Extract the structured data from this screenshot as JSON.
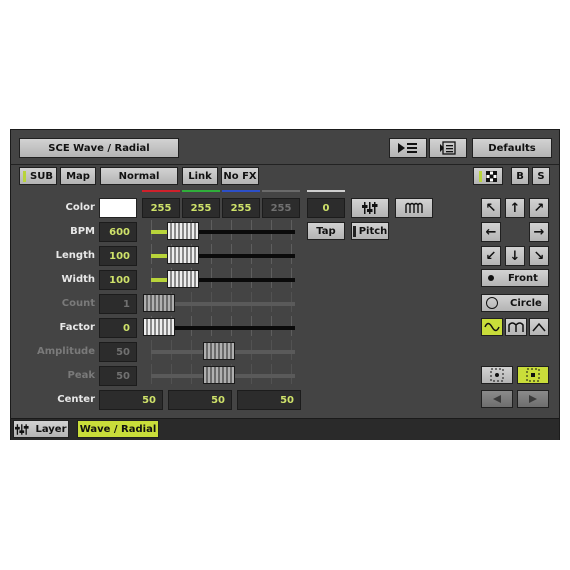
{
  "header": {
    "title": "SCE Wave / Radial",
    "defaults_label": "Defaults"
  },
  "tabs": {
    "sub": "SUB",
    "map": "Map",
    "mode": "Normal",
    "link": "Link",
    "nofx": "No FX",
    "b": "B",
    "s": "S"
  },
  "params": {
    "color": {
      "label": "Color",
      "r": "255",
      "g": "255",
      "b": "255",
      "w": "255",
      "alpha": "0"
    },
    "bpm": {
      "label": "BPM",
      "value": "600",
      "slider": 0.2
    },
    "length": {
      "label": "Length",
      "value": "100",
      "slider": 0.2
    },
    "width": {
      "label": "Width",
      "value": "100",
      "slider": 0.2
    },
    "count": {
      "label": "Count",
      "value": "1",
      "slider": 0.0
    },
    "factor": {
      "label": "Factor",
      "value": "0",
      "slider": 0.0
    },
    "amplitude": {
      "label": "Amplitude",
      "value": "50",
      "slider": 0.5
    },
    "peak": {
      "label": "Peak",
      "value": "50",
      "slider": 0.5
    },
    "center": {
      "label": "Center",
      "x": "50",
      "y": "50",
      "z": "50"
    }
  },
  "buttons": {
    "tap": "Tap",
    "pitch": "Pitch",
    "front": "Front",
    "circle": "Circle"
  },
  "footer": {
    "layer": "Layer",
    "active_tab": "Wave / Radial"
  },
  "colors": {
    "accent": "#c9dd3a",
    "panel": "#444444",
    "red": "#d0202a",
    "green": "#2fae3a",
    "blue": "#2c4fc8"
  }
}
